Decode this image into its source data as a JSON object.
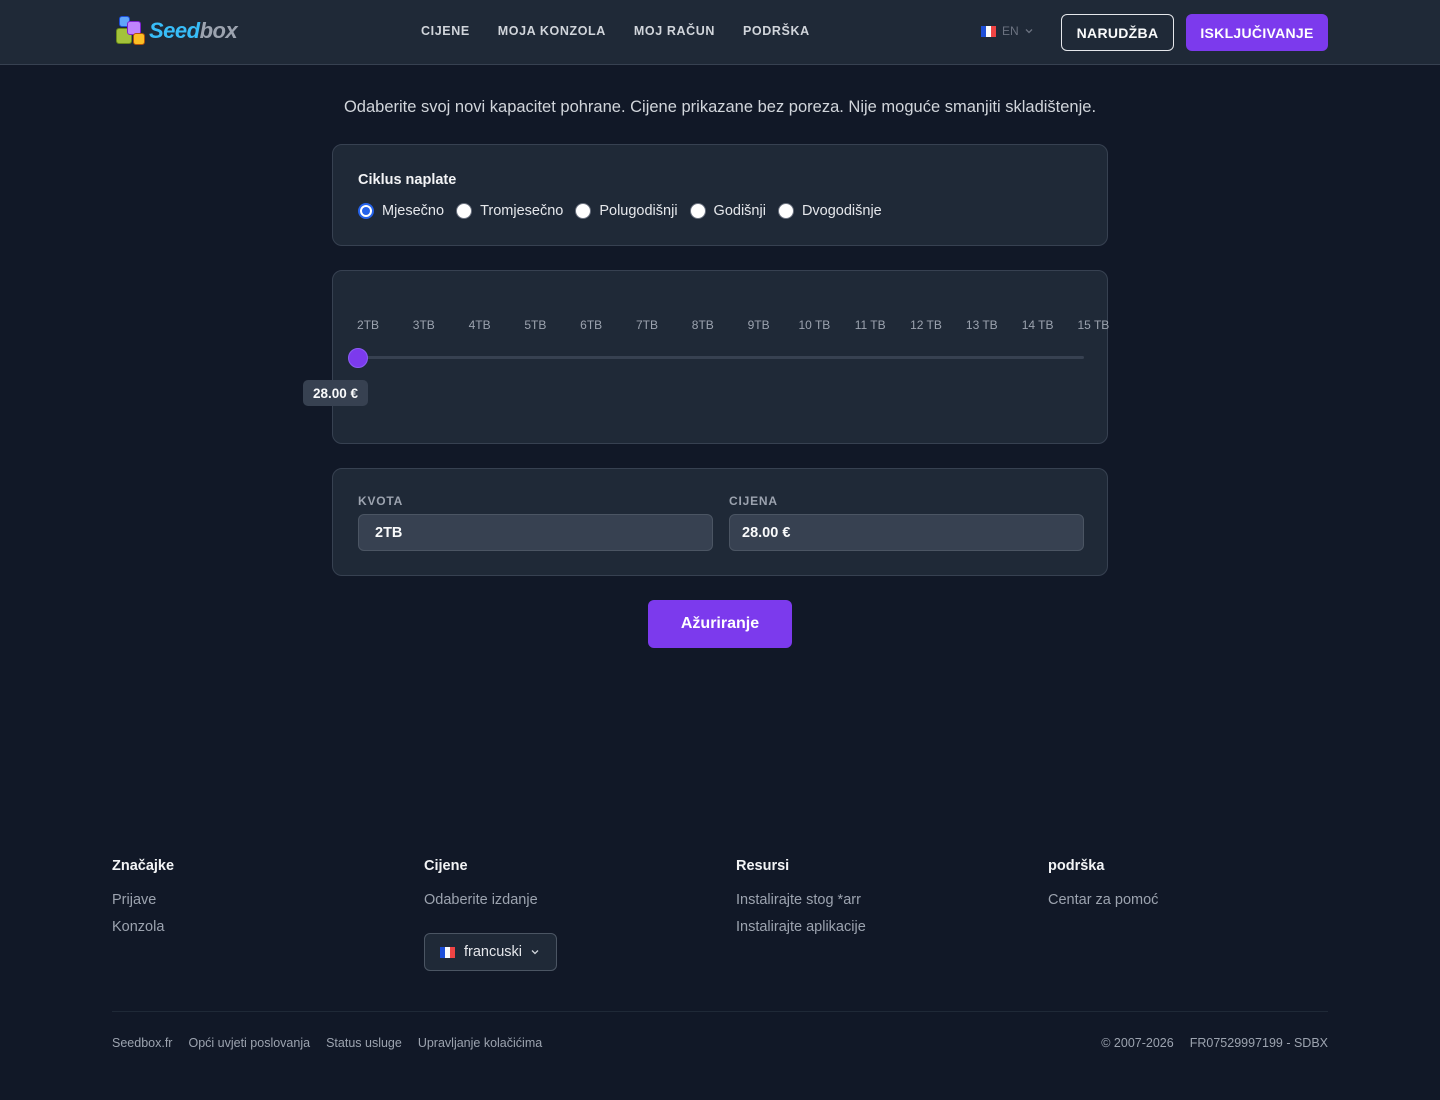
{
  "header": {
    "logo": {
      "part1": "Seed",
      "part2": "box"
    },
    "nav": [
      "CIJENE",
      "MOJA KONZOLA",
      "MOJ RAČUN",
      "PODRŠKA"
    ],
    "language": "EN",
    "order_label": "NARUDŽBA",
    "logout_label": "ISKLJUČIVANJE"
  },
  "main": {
    "intro": "Odaberite svoj novi kapacitet pohrane. Cijene prikazane bez poreza. Nije moguće smanjiti skladištenje.",
    "billing": {
      "title": "Ciklus naplate",
      "options": [
        "Mjesečno",
        "Tromjesečno",
        "Polugodišnji",
        "Godišnji",
        "Dvogodišnje"
      ],
      "selected": 0
    },
    "slider": {
      "ticks": [
        "2TB",
        "3TB",
        "4TB",
        "5TB",
        "6TB",
        "7TB",
        "8TB",
        "9TB",
        "10 TB",
        "11 TB",
        "12 TB",
        "13 TB",
        "14 TB",
        "15 TB"
      ],
      "value_index": 0,
      "price_bubble": "28.00 €"
    },
    "summary": {
      "quota_label": "KVOTA",
      "quota_value": "2TB",
      "price_label": "CIJENA",
      "price_value": "28.00 €"
    },
    "update_label": "Ažuriranje"
  },
  "footer": {
    "columns": [
      {
        "title": "Značajke",
        "links": [
          "Prijave",
          "Konzola"
        ]
      },
      {
        "title": "Cijene",
        "links": [
          "Odaberite izdanje"
        ]
      },
      {
        "title": "Resursi",
        "links": [
          "Instalirajte stog *arr",
          "Instalirajte aplikacije"
        ]
      },
      {
        "title": "podrška",
        "links": [
          "Centar za pomoć"
        ]
      }
    ],
    "language_select": "francuski",
    "bottom_links": [
      "Seedbox.fr",
      "Opći uvjeti poslovanja",
      "Status usluge",
      "Upravljanje kolačićima"
    ],
    "copyright": "© 2007-2026",
    "company_id": "FR07529997199 - SDBX"
  },
  "colors": {
    "accent": "#7c3aed",
    "background": "#111827",
    "surface": "#1f2937",
    "radio_checked": "#2563eb"
  },
  "icons": [
    "logo-cubes-icon",
    "france-flag-icon",
    "chevron-down-icon"
  ]
}
